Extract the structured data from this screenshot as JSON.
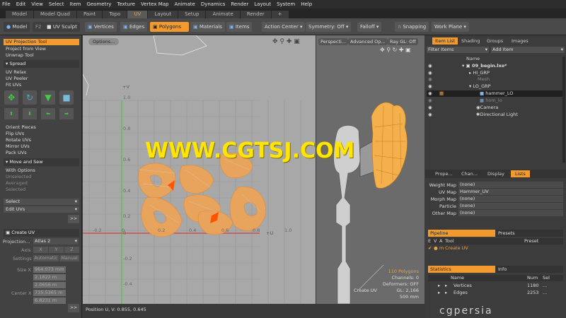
{
  "menu": [
    "File",
    "Edit",
    "View",
    "Select",
    "Item",
    "Geometry",
    "Texture",
    "Vertex Map",
    "Animate",
    "Dynamics",
    "Render",
    "Layout",
    "System",
    "Help"
  ],
  "tabs": [
    "Model",
    "Model Quad",
    "Paint",
    "Topo",
    "UV",
    "Layout",
    "Setup",
    "Animate",
    "Render",
    "+"
  ],
  "toolbar": {
    "model": "Model",
    "f2": "F2",
    "uv_sculpt": "UV Sculpt",
    "vertices": "Vertices",
    "edges": "Edges",
    "polygons": "Polygons",
    "materials": "Materials",
    "items": "Items",
    "action_center": "Action Center",
    "symmetry": "Symmetry: Off",
    "falloff": "Falloff",
    "snapping": "Snapping",
    "work_plane": "Work Plane"
  },
  "left": {
    "uv_proj": "UV Projection Tool",
    "proj_view": "Project from View",
    "unwrap": "Unwrap Tool",
    "spread_hdr": "Spread",
    "uv_relax": "UV Relax",
    "uv_peeler": "UV Peeler",
    "fit_uvs": "Fit UVs",
    "orient": "Orient Pieces",
    "flip": "Flip UVs",
    "rotate": "Rotate UVs",
    "mirror": "Mirror UVs",
    "pack": "Pack UVs",
    "move_hdr": "Move and Sew",
    "with_options": "With Options",
    "unselected": "Unselected",
    "averaged": "Averaged",
    "selected": "Selected",
    "select": "Select",
    "edit_uvs": "Edit UVs",
    "create_uv": "Create UV",
    "projection_label": "Projection...",
    "projection_val": "Atlas 2",
    "axis_label": "Axis",
    "axis_x": "X",
    "axis_y": "Y",
    "axis_z": "Z",
    "settings_label": "Settings",
    "settings_auto": "Automatic",
    "settings_manual": "Manual",
    "size_label": "Size X",
    "size_x": "964.073 mm",
    "size_y": "2.1822 m",
    "size_z": "2.0656 m",
    "center_label": "Center X",
    "center_x": "735.5365 m",
    "center_y": "6.8231 m",
    "arrow": ">>"
  },
  "viewport": {
    "options": "Options...",
    "plus_v": "+V",
    "plus_u": "+U",
    "v_ticks": [
      "1.0",
      "0.8",
      "0.6",
      "0.4",
      "0.2",
      "0",
      "-0.2",
      "-0.4"
    ],
    "u_ticks": [
      "-0.2",
      "0",
      "0.2",
      "0.4",
      "0.6",
      "0.8",
      "1.0"
    ],
    "position": "Position U, V:  0.855, 0.645"
  },
  "vp2": {
    "perspective": "Perspecti...",
    "advanced": "Advanced Op...",
    "ray_gl": "Ray GL: Off",
    "polygons": "110 Polygons",
    "channels": "Channels: 0",
    "deformers": "Deformers: OFF",
    "gl": "GL: 2,166",
    "mm": "500 mm",
    "create_uv": "Create UV"
  },
  "right": {
    "tabs": [
      "Item List",
      "Shading",
      "Groups",
      "Images"
    ],
    "filter": "Filter Items",
    "add_item": "Add Item",
    "name_col": "Name",
    "tree": [
      "09_begin.lxo*",
      "HI_GRP",
      "Mesh",
      "LO_GRP",
      "hammer_LO",
      "hom_lo",
      "Camera",
      "Directional Light"
    ],
    "prop_tabs": [
      "Prope...",
      "Chan...",
      "Display",
      "Lists"
    ],
    "weight_label": "Weight Map",
    "weight_val": "(none)",
    "uv_label": "UV Map",
    "uv_val": "Hammer_UV",
    "morph_label": "Morph Map",
    "morph_val": "(none)",
    "particle_label": "Particle",
    "particle_val": "(none)",
    "other_label": "Other Map",
    "other_val": "(none)",
    "pipeline": "Pipeline",
    "presets": "Presets",
    "pipe_cols": [
      "E",
      "V",
      "A",
      "Tool",
      "Preset"
    ],
    "pipe_row_flag": "m",
    "pipe_row": "Create UV",
    "statistics": "Statistics",
    "info": "Info",
    "stat_cols": [
      "Name",
      "Num",
      "Sel"
    ],
    "stat_rows": [
      {
        "name": "Vertices",
        "num": "1180",
        "sel": "..."
      },
      {
        "name": "Edges",
        "num": "2253",
        "sel": "..."
      }
    ],
    "logo": "cgpersia"
  },
  "watermark": "WWW.CGTSJ.COM"
}
